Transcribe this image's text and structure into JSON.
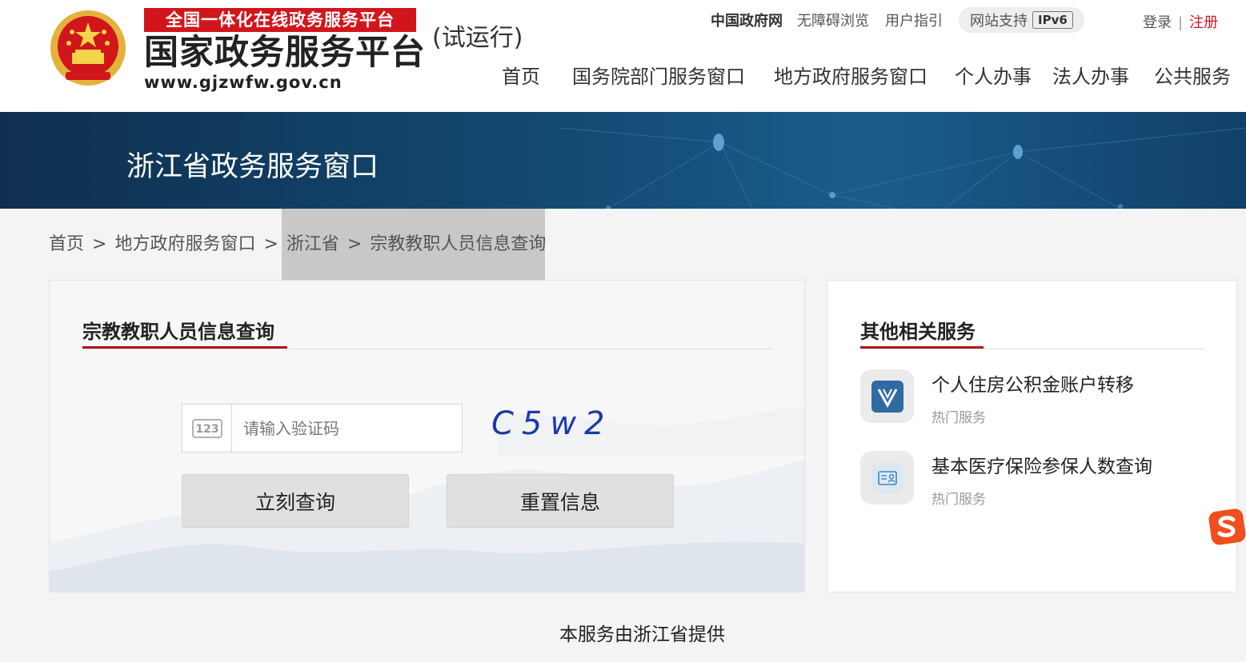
{
  "header": {
    "ribbon": "全国一体化在线政务服务平台",
    "site_title": "国家政务服务平台",
    "site_url": "www.gjzwfw.gov.cn",
    "trial": "(试运行)",
    "top_links": [
      "中国政府网",
      "无障碍浏览",
      "用户指引"
    ],
    "ipv6_label": "网站支持",
    "ipv6_badge": "IPv6",
    "login": "登录",
    "separator": "|",
    "register": "注册",
    "nav": [
      "首页",
      "国务院部门服务窗口",
      "地方政府服务窗口",
      "个人办事",
      "法人办事",
      "公共服务"
    ]
  },
  "banner": {
    "title": "浙江省政务服务窗口"
  },
  "breadcrumb": {
    "items": [
      "首页",
      "地方政府服务窗口",
      "浙江省",
      "宗教教职人员信息查询"
    ],
    "separator": ">"
  },
  "query_panel": {
    "title": "宗教教职人员信息查询",
    "captcha_icon_text": "123",
    "captcha_placeholder": "请输入验证码",
    "captcha_value": "",
    "captcha_image_text": "C5w2",
    "query_button": "立刻查询",
    "reset_button": "重置信息"
  },
  "related_panel": {
    "title": "其他相关服务",
    "services": [
      {
        "name": "个人住房公积金账户转移",
        "tag": "热门服务",
        "icon": "v-badge-icon",
        "icon_color": "#2f6aa3"
      },
      {
        "name": "基本医疗保险参保人数查询",
        "tag": "热门服务",
        "icon": "id-card-icon",
        "icon_color": "#3a86c8"
      }
    ]
  },
  "footer": {
    "provider": "本服务由浙江省提供"
  },
  "colors": {
    "accent_red": "#d1161b",
    "banner_blue": "#134a73"
  }
}
